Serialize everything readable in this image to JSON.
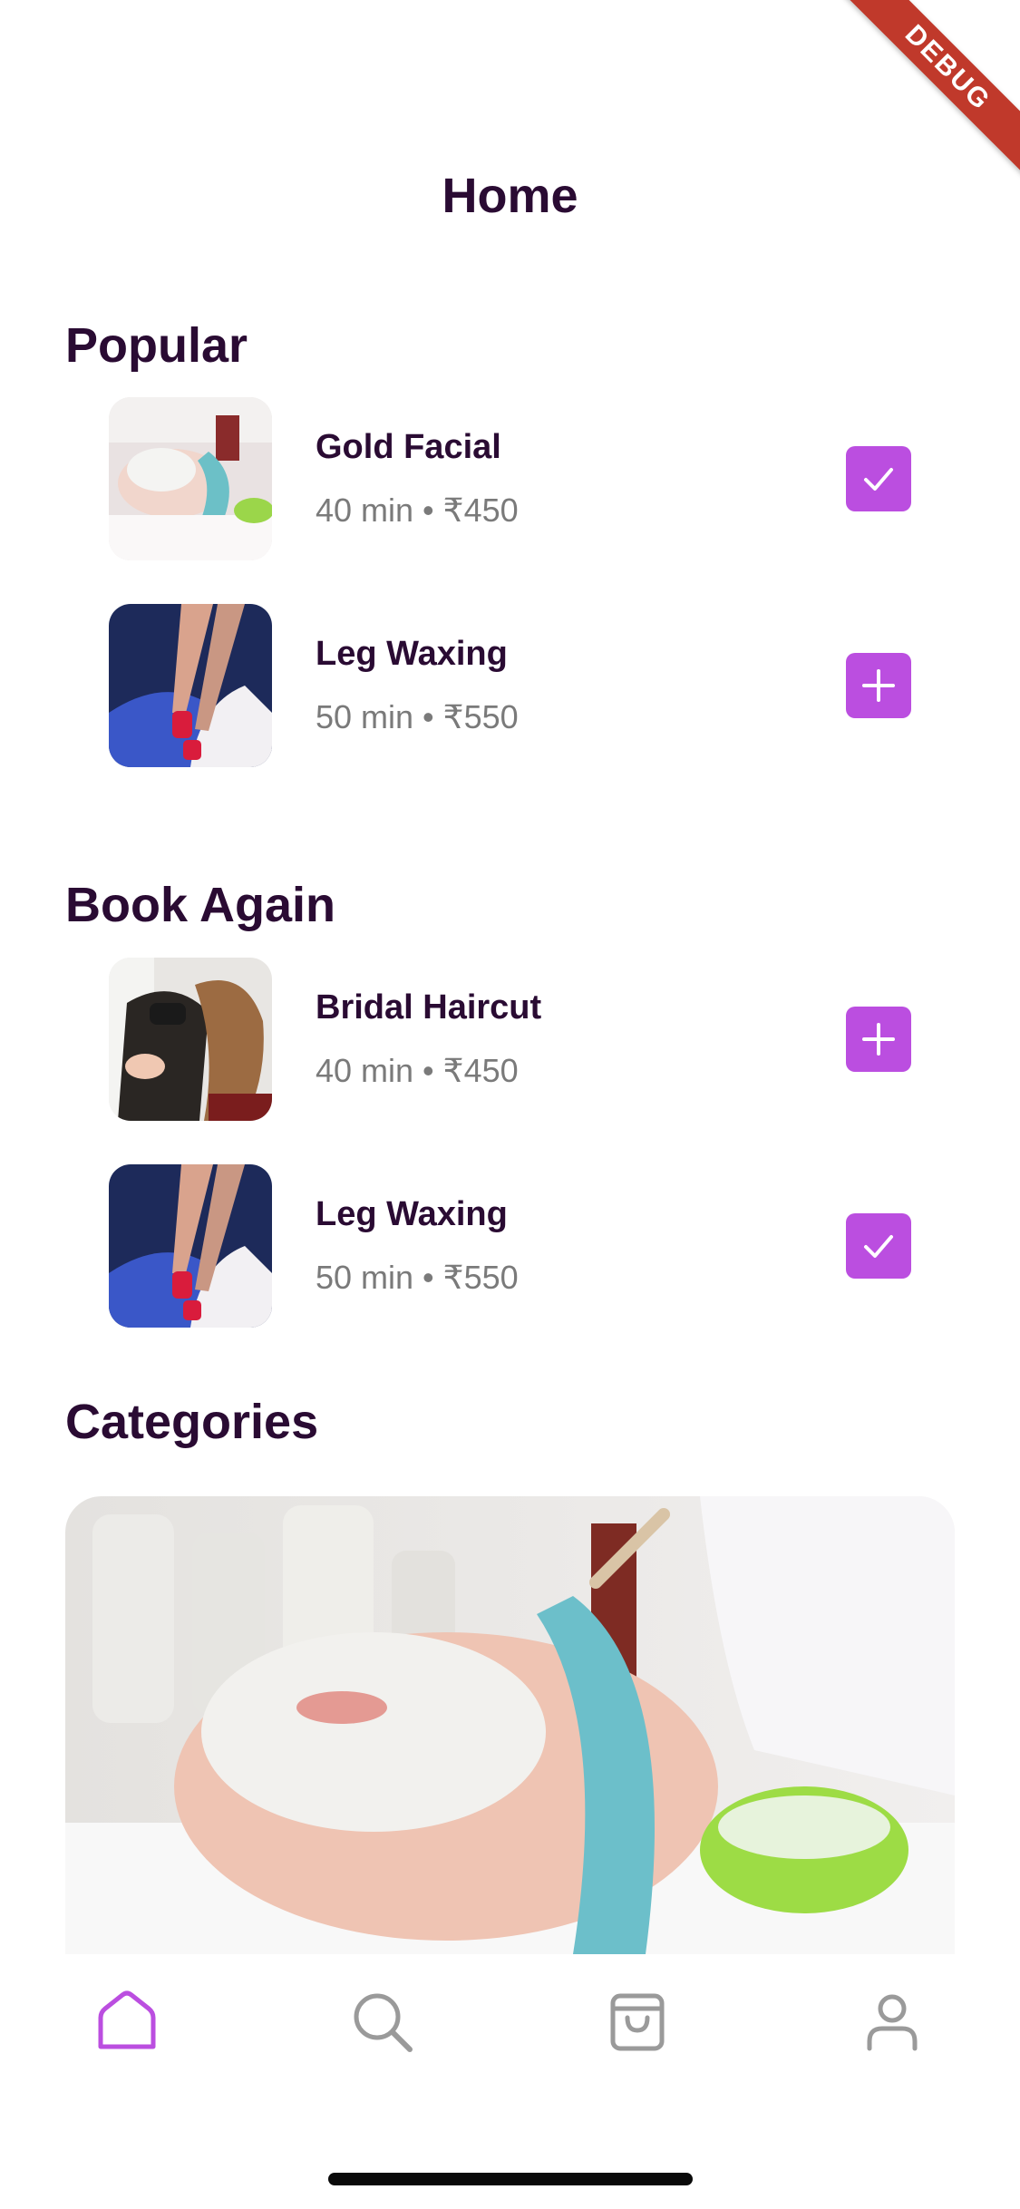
{
  "debug": {
    "label": "DEBUG"
  },
  "header": {
    "title": "Home"
  },
  "popular": {
    "title": "Popular",
    "items": [
      {
        "name": "Gold Facial",
        "meta": "40 min • ₹450",
        "action": "check-icon"
      },
      {
        "name": "Leg Waxing",
        "meta": "50 min • ₹550",
        "action": "plus-icon"
      }
    ]
  },
  "book_again": {
    "title": "Book Again",
    "items": [
      {
        "name": "Bridal Haircut",
        "meta": "40 min • ₹450",
        "action": "plus-icon"
      },
      {
        "name": "Leg Waxing",
        "meta": "50 min • ₹550",
        "action": "check-icon"
      }
    ]
  },
  "categories": {
    "title": "Categories"
  },
  "nav": {
    "items": [
      "home-icon",
      "search-icon",
      "bag-icon",
      "profile-icon"
    ],
    "active_color": "#bb4ee0",
    "inactive_color": "#9a9a9a"
  },
  "colors": {
    "accent": "#bb4ee0",
    "text": "#2a0b33",
    "muted": "#7a7a7a"
  }
}
